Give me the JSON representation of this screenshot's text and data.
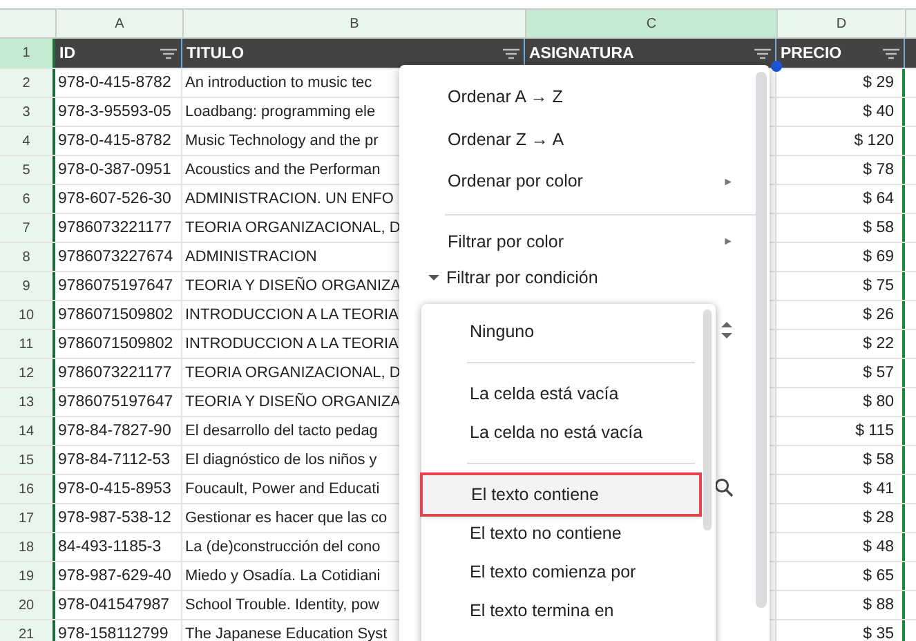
{
  "columns": [
    {
      "letter": "A",
      "selected": false
    },
    {
      "letter": "B",
      "selected": false
    },
    {
      "letter": "C",
      "selected": true
    },
    {
      "letter": "D",
      "selected": false
    }
  ],
  "header_row": {
    "number": "1",
    "selected": true,
    "cells": [
      "ID",
      "TITULO",
      "ASIGNATURA",
      "PRECIO"
    ]
  },
  "rows": [
    {
      "number": "2",
      "id": "978-0-415-8782",
      "title": "An introduction to music tec",
      "price": "$ 29"
    },
    {
      "number": "3",
      "id": "978-3-95593-05",
      "title": "Loadbang: programming ele",
      "price": "$ 40"
    },
    {
      "number": "4",
      "id": "978-0-415-8782",
      "title": "Music Technology and the pr",
      "price": "$ 120"
    },
    {
      "number": "5",
      "id": "978-0-387-0951",
      "title": "Acoustics and the Performan",
      "price": "$ 78"
    },
    {
      "number": "6",
      "id": "978-607-526-30",
      "title": "ADMINISTRACION. UN ENFO",
      "price": "$ 64"
    },
    {
      "number": "7",
      "id": "9786073221177",
      "title": "TEORIA ORGANIZACIONAL, D",
      "price": "$ 58"
    },
    {
      "number": "8",
      "id": "9786073227674",
      "title": "ADMINISTRACION",
      "price": "$ 69"
    },
    {
      "number": "9",
      "id": "9786075197647",
      "title": "TEORIA Y DISEÑO ORGANIZA",
      "price": "$ 75"
    },
    {
      "number": "10",
      "id": "9786071509802",
      "title": "INTRODUCCION A LA TEORIA",
      "price": "$ 26"
    },
    {
      "number": "11",
      "id": "9786071509802",
      "title": "INTRODUCCION A LA TEORIA",
      "price": "$ 22"
    },
    {
      "number": "12",
      "id": "9786073221177",
      "title": "TEORIA ORGANIZACIONAL, D",
      "price": "$ 57"
    },
    {
      "number": "13",
      "id": "9786075197647",
      "title": "TEORIA Y DISEÑO ORGANIZA",
      "price": "$ 80"
    },
    {
      "number": "14",
      "id": "978-84-7827-90",
      "title": "El desarrollo del tacto pedag",
      "price": "$ 115"
    },
    {
      "number": "15",
      "id": "978-84-7112-53",
      "title": "El diagnóstico de los niños y",
      "price": "$ 58"
    },
    {
      "number": "16",
      "id": "978-0-415-8953",
      "title": "Foucault, Power and Educati",
      "price": "$ 41"
    },
    {
      "number": "17",
      "id": "978-987-538-12",
      "title": "Gestionar es hacer que las co",
      "price": "$ 28"
    },
    {
      "number": "18",
      "id": "84-493-1185-3",
      "title": "La (de)construcción del cono",
      "price": "$ 48"
    },
    {
      "number": "19",
      "id": "978-987-629-40",
      "title": "Miedo y Osadía. La Cotidiani",
      "price": "$ 65"
    },
    {
      "number": "20",
      "id": "978-041547987",
      "title": "School Trouble. Identity, pow",
      "price": "$ 88"
    },
    {
      "number": "21",
      "id": "978-158112799",
      "title": "The Japanese Education Syst",
      "price": "$ 35"
    }
  ],
  "menu": {
    "items": [
      {
        "kind": "item",
        "label": "Ordenar A → Z"
      },
      {
        "kind": "item",
        "label": "Ordenar Z → A"
      },
      {
        "kind": "submenu",
        "label": "Ordenar por color",
        "arrow": "►"
      },
      {
        "kind": "divider"
      },
      {
        "kind": "submenu",
        "label": "Filtrar por color",
        "arrow": "►"
      },
      {
        "kind": "section",
        "label": "Filtrar por condición",
        "expanded": true
      }
    ]
  },
  "condition_options": [
    {
      "kind": "option",
      "label": "Ninguno",
      "selected": false
    },
    {
      "kind": "divider"
    },
    {
      "kind": "option",
      "label": "La celda está vacía",
      "selected": false
    },
    {
      "kind": "option",
      "label": "La celda no está vacía",
      "selected": false
    },
    {
      "kind": "divider"
    },
    {
      "kind": "option",
      "label": "El texto contiene",
      "selected": true
    },
    {
      "kind": "option",
      "label": "El texto no contiene",
      "selected": false
    },
    {
      "kind": "option",
      "label": "El texto comienza por",
      "selected": false
    },
    {
      "kind": "option",
      "label": "El texto termina en",
      "selected": false
    }
  ]
}
